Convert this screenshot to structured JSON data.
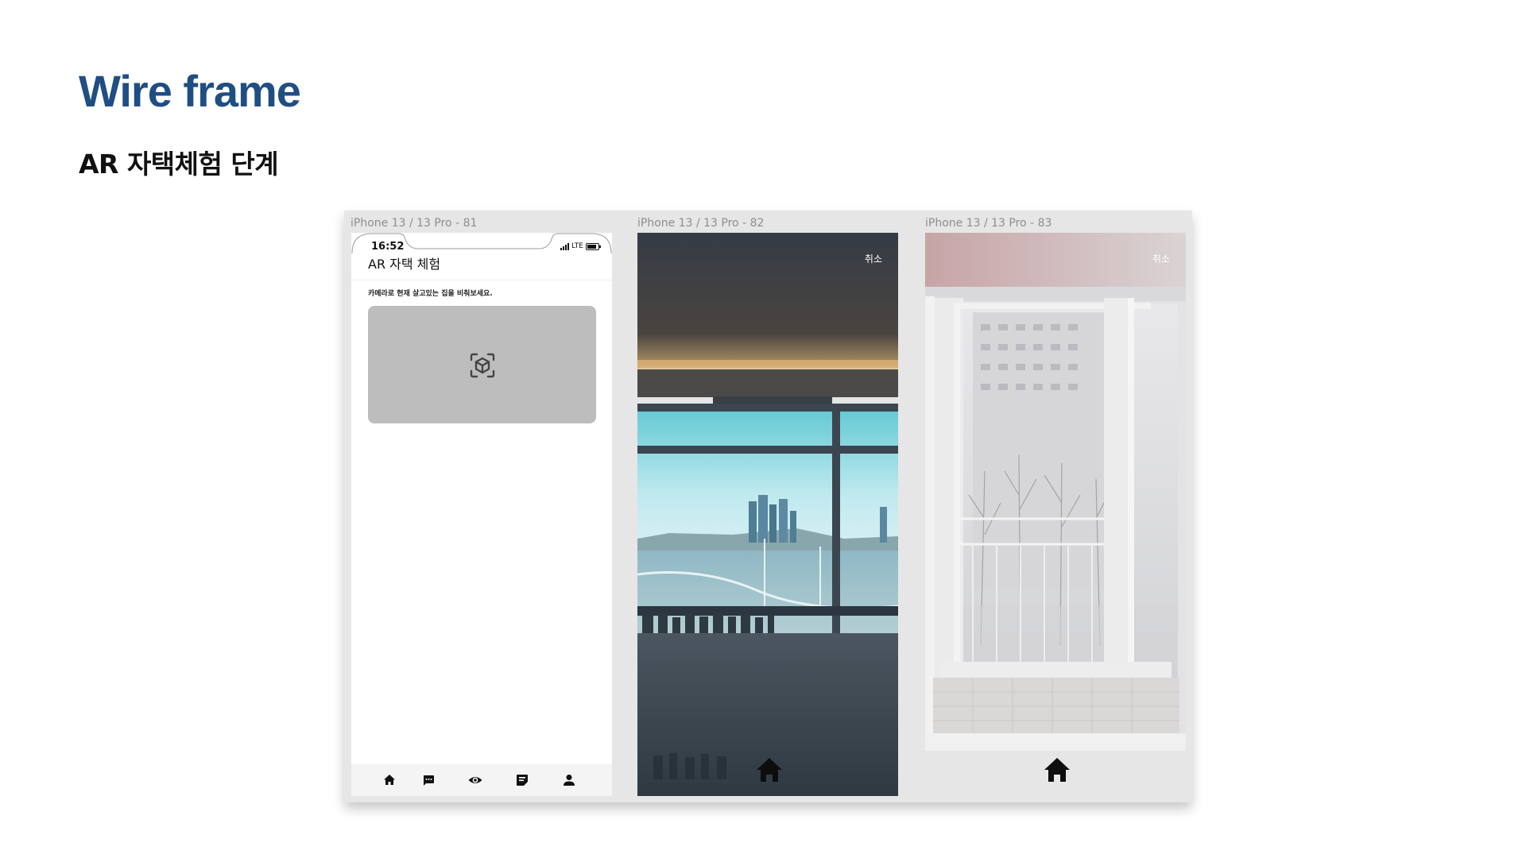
{
  "slide": {
    "title": "Wire frame",
    "subtitle": "AR 자택체험 단계"
  },
  "frames": [
    {
      "label": "iPhone 13 / 13 Pro - 81",
      "status_time": "16:52",
      "status_network": "LTE",
      "screen_title": "AR 자택 체험",
      "instruction": "카메라로 현재 살고있는 집을 비춰보세요.",
      "ar_icon": "ar-cube-scan-icon",
      "tabbar": [
        "home-icon",
        "chat-icon",
        "eye-icon",
        "note-icon",
        "person-icon"
      ]
    },
    {
      "label": "iPhone 13 / 13 Pro - 82",
      "cancel_label": "취소",
      "home_icon": "home-icon"
    },
    {
      "label": "iPhone 13 / 13 Pro - 83",
      "cancel_label": "취소",
      "home_icon": "home-icon"
    }
  ],
  "colors": {
    "title": "#1f4e82",
    "canvas_bg": "#e6e6e6",
    "ar_box": "#bdbdbd"
  }
}
